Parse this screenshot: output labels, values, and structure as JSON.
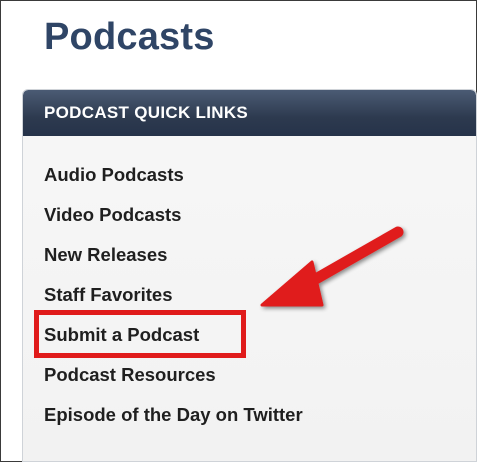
{
  "page": {
    "title": "Podcasts"
  },
  "quick_links": {
    "header": "PODCAST QUICK LINKS",
    "items": [
      {
        "label": "Audio Podcasts"
      },
      {
        "label": "Video Podcasts"
      },
      {
        "label": "New Releases"
      },
      {
        "label": "Staff Favorites"
      },
      {
        "label": "Submit a Podcast"
      },
      {
        "label": "Podcast Resources"
      },
      {
        "label": "Episode of the Day on Twitter"
      }
    ]
  },
  "annotation": {
    "highlighted_item": "Submit a Podcast",
    "color": "#e01b1b"
  },
  "colors": {
    "title": "#2f4566",
    "header_bg": "#2d3a4f",
    "header_text": "#ffffff",
    "link_text": "#1f1f1f"
  }
}
